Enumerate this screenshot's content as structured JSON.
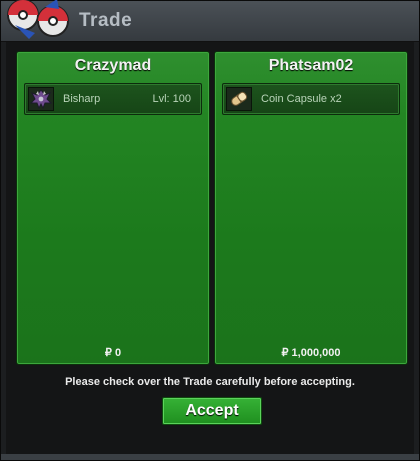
{
  "window": {
    "title": "Trade",
    "logo_icon": "pokeball-logo-icon"
  },
  "trade": {
    "left": {
      "player_name": "Crazymad",
      "item": {
        "icon": "bisharp-sprite-icon",
        "name": "Bisharp",
        "level_text": "Lvl: 100"
      },
      "money_text": "₽ 0"
    },
    "right": {
      "player_name": "Phatsam02",
      "item": {
        "icon": "coin-capsule-icon",
        "name": "Coin Capsule  x2"
      },
      "money_text": "₽ 1,000,000"
    }
  },
  "notice_text": "Please check over the Trade carefully before accepting.",
  "accept_label": "Accept",
  "colors": {
    "panel_green": "#1f7f1f",
    "accept_green": "#2aa32a",
    "titlebar": "#40464c"
  }
}
